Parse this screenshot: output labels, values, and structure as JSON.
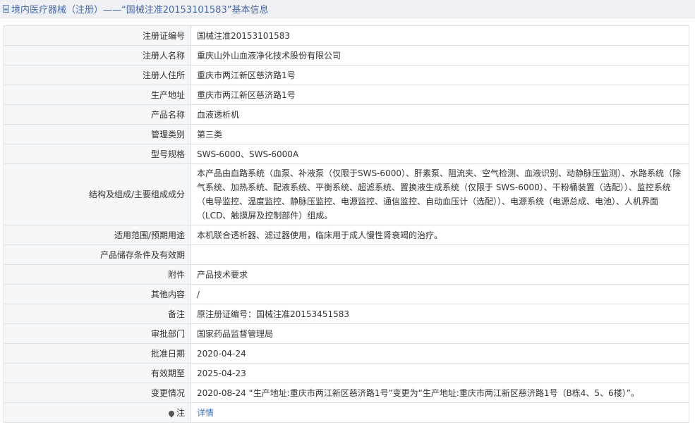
{
  "header": {
    "title": "境内医疗器械（注册）——“国械注准20153101583”基本信息"
  },
  "rows": [
    {
      "label": "注册证编号",
      "value": "国械注准20153101583"
    },
    {
      "label": "注册人名称",
      "value": "重庆山外山血液净化技术股份有限公司"
    },
    {
      "label": "注册人住所",
      "value": "重庆市两江新区慈济路1号"
    },
    {
      "label": "生产地址",
      "value": "重庆市两江新区慈济路1号"
    },
    {
      "label": "产品名称",
      "value": "血液透析机"
    },
    {
      "label": "管理类别",
      "value": "第三类"
    },
    {
      "label": "型号规格",
      "value": "SWS-6000、SWS-6000A"
    },
    {
      "label": "结构及组成/主要组成成分",
      "value": "本产品由血路系统（血泵、补液泵（仅限于SWS-6000）、肝素泵、阻流夹、空气检测、血液识别、动静脉压监测）、水路系统（除气系统、加热系统、配液系统、平衡系统、超滤系统、置换液生成系统（仅限于 SWS-6000）、干粉桶装置（选配））、监控系统（电导监控、温度监控、静脉压监控、电源监控、通信监控、自动血压计（选配））、电源系统（电源总成、电池）、人机界面（LCD、触摸屏及控制部件）组成。"
    },
    {
      "label": "适用范围/预期用途",
      "value": "本机联合透析器、滤过器使用，临床用于成人慢性肾衰竭的治疗。"
    },
    {
      "label": "产品储存条件及有效期",
      "value": ""
    },
    {
      "label": "附件",
      "value": "产品技术要求"
    },
    {
      "label": "其他内容",
      "value": "/"
    },
    {
      "label": "备注",
      "value": "原注册证编号：国械注准20153451583"
    },
    {
      "label": "审批部门",
      "value": "国家药品监督管理局"
    },
    {
      "label": "批准日期",
      "value": "2020-04-24"
    },
    {
      "label": "有效期至",
      "value": "2025-04-23"
    },
    {
      "label": "变更情况",
      "value": "2020-08-24 “生产地址:重庆市两江新区慈济路1号”变更为“生产地址:重庆市两江新区慈济路1号（B栋4、5、6楼）”。"
    }
  ],
  "note_row": {
    "icon": "pin-icon",
    "label": "注",
    "link_text": "详情"
  },
  "colors": {
    "title": "#496aa8",
    "label_bg": "#f5f6f8",
    "border": "#dcdfe4",
    "link": "#3a76c4"
  }
}
